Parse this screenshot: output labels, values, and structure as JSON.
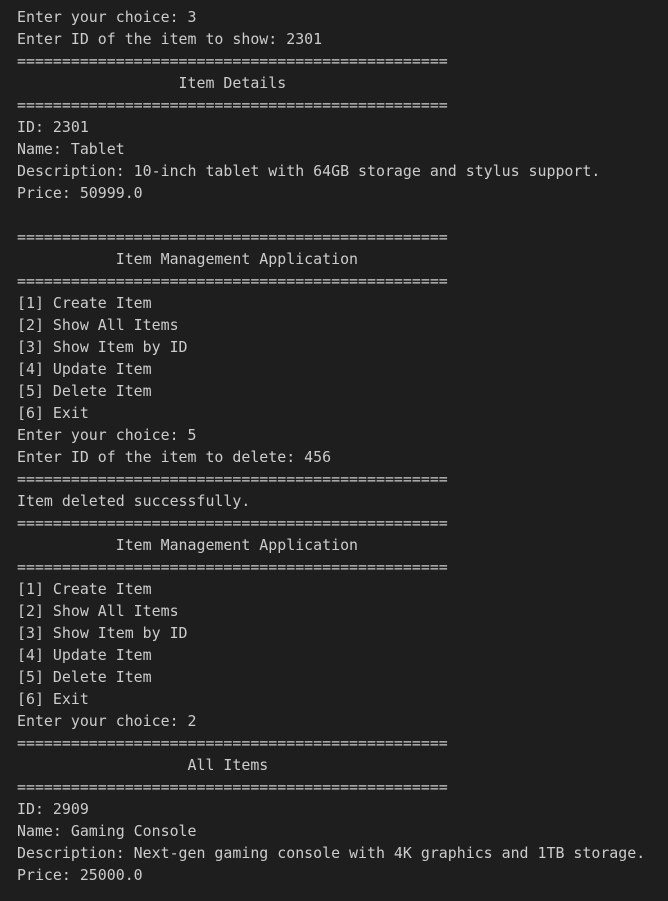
{
  "terminal": {
    "lines": [
      "Enter your choice: 3",
      "Enter ID of the item to show: 2301",
      "================================================",
      "                  Item Details",
      "================================================",
      "ID: 2301",
      "Name: Tablet",
      "Description: 10-inch tablet with 64GB storage and stylus support.",
      "Price: 50999.0",
      "",
      "================================================",
      "           Item Management Application",
      "================================================",
      "[1] Create Item",
      "[2] Show All Items",
      "[3] Show Item by ID",
      "[4] Update Item",
      "[5] Delete Item",
      "[6] Exit",
      "Enter your choice: 5",
      "Enter ID of the item to delete: 456",
      "================================================",
      "Item deleted successfully.",
      "================================================",
      "           Item Management Application",
      "================================================",
      "[1] Create Item",
      "[2] Show All Items",
      "[3] Show Item by ID",
      "[4] Update Item",
      "[5] Delete Item",
      "[6] Exit",
      "Enter your choice: 2",
      "================================================",
      "                   All Items",
      "================================================",
      "ID: 2909",
      "Name: Gaming Console",
      "Description: Next-gen gaming console with 4K graphics and 1TB storage.",
      "Price: 25000.0"
    ]
  }
}
